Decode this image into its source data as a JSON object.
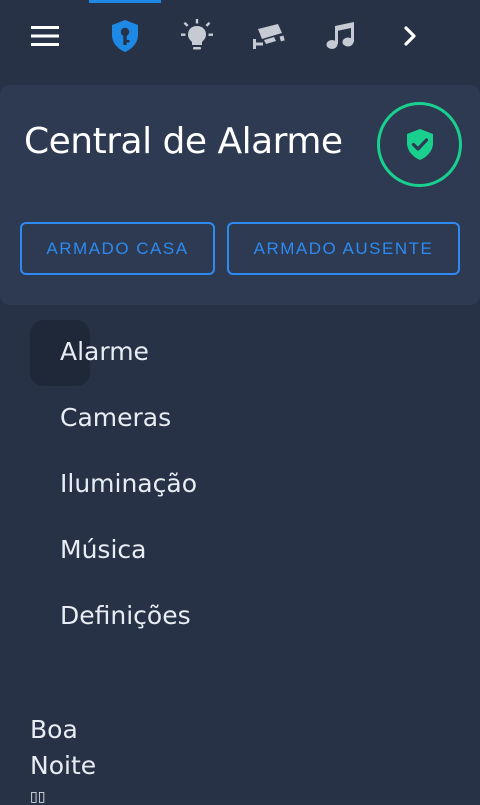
{
  "colors": {
    "background": "#273246",
    "card": "#2d3a52",
    "accent_blue": "#2d8af0",
    "status_green": "#19d08f",
    "icon_grey": "#c5cad3"
  },
  "tabs": [
    {
      "icon": "menu-icon"
    },
    {
      "icon": "shield-key-icon",
      "active": true
    },
    {
      "icon": "lightbulb-icon"
    },
    {
      "icon": "cctv-camera-icon"
    },
    {
      "icon": "music-note-icon"
    },
    {
      "icon": "chevron-right-icon"
    }
  ],
  "card": {
    "title": "Central de Alarme",
    "status_icon": "shield-check-icon",
    "buttons": {
      "armado_casa": "ARMADO CASA",
      "armado_ausente": "ARMADO AUSENTE"
    }
  },
  "menu": {
    "items": [
      {
        "label": "Alarme"
      },
      {
        "label": "Cameras"
      },
      {
        "label": "Iluminação"
      },
      {
        "label": "Música"
      },
      {
        "label": "Definições"
      }
    ]
  },
  "greeting": {
    "line1": "Boa",
    "line2": "Noite",
    "glyph": "▯▯"
  }
}
